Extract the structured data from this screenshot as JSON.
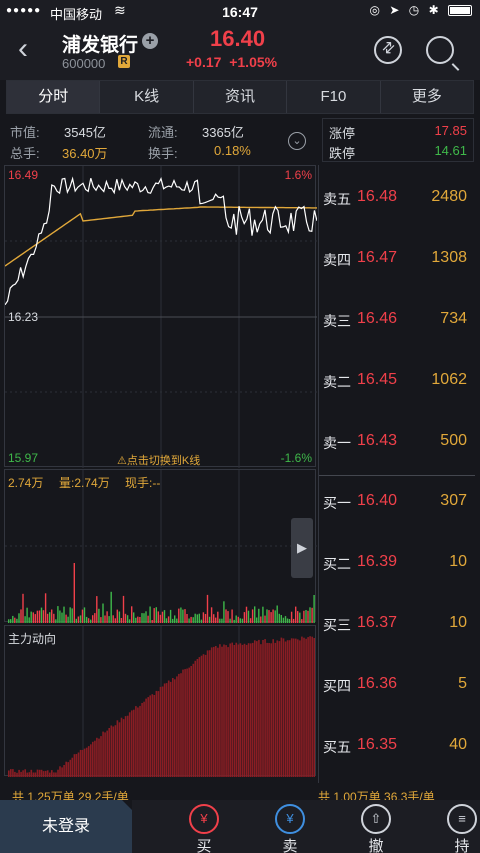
{
  "status_bar": {
    "signal": "●●●●●",
    "carrier": "中国移动",
    "time": "16:47"
  },
  "header": {
    "stock_name": "浦发银行",
    "stock_code": "600000",
    "badge": "R",
    "price": "16.40",
    "change": "+0.17",
    "change_pct": "+1.05%"
  },
  "tabs": [
    "分时",
    "K线",
    "资讯",
    "F10",
    "更多"
  ],
  "info": {
    "market_cap_label": "市值:",
    "market_cap": "3545亿",
    "float_label": "流通:",
    "float_value": "3365亿",
    "volume_label": "总手:",
    "volume": "36.40万",
    "turnover_label": "换手:",
    "turnover": "0.18%"
  },
  "limits": {
    "up_label": "涨停",
    "up_value": "17.85",
    "down_label": "跌停",
    "down_value": "14.61"
  },
  "intraday": {
    "high_label": "16.49",
    "high_pct": "1.6%",
    "mid_label": "16.23",
    "low_label": "15.97",
    "low_pct": "-1.6%",
    "hint": "⚠点击切换到K线"
  },
  "volume_panel": {
    "total": "2.74万",
    "amount_label": "量:2.74万",
    "current_label": "现手:--"
  },
  "main_force_panel": {
    "title": "主力动向"
  },
  "order_book": {
    "asks": [
      {
        "name": "卖五",
        "price": "16.48",
        "volume": "2480"
      },
      {
        "name": "卖四",
        "price": "16.47",
        "volume": "1308"
      },
      {
        "name": "卖三",
        "price": "16.46",
        "volume": "734"
      },
      {
        "name": "卖二",
        "price": "16.45",
        "volume": "1062"
      },
      {
        "name": "卖一",
        "price": "16.43",
        "volume": "500"
      }
    ],
    "bids": [
      {
        "name": "买一",
        "price": "16.40",
        "volume": "307"
      },
      {
        "name": "买二",
        "price": "16.39",
        "volume": "10"
      },
      {
        "name": "买三",
        "price": "16.37",
        "volume": "10"
      },
      {
        "name": "买四",
        "price": "16.36",
        "volume": "5"
      },
      {
        "name": "买五",
        "price": "16.35",
        "volume": "40"
      }
    ]
  },
  "summary": {
    "left": "共 1.25万单   29.2手/单",
    "right": "共 1.00万单   36.3手/单"
  },
  "bottom_bar": {
    "login": "未登录",
    "buy": "买",
    "sell": "卖",
    "cancel": "撤",
    "hold": "持"
  },
  "colors": {
    "up": "#f0404a",
    "down": "#3fb84a",
    "avg_line": "#e1a83a",
    "price_line": "#ffffff"
  }
}
